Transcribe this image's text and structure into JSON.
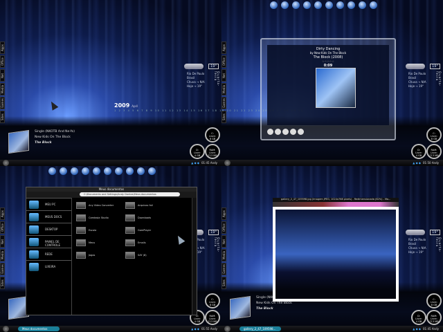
{
  "sidebar_tabs": [
    "Apps",
    "Office",
    "Net",
    "Media",
    "Games",
    "Sites"
  ],
  "weather": {
    "temp": "19°",
    "city": "Rio De Paulo",
    "country": "Brasil",
    "line1": "Chuva → N/A",
    "line2": "Hoje → 19°",
    "label": "Quarta-feira"
  },
  "drives": [
    {
      "name": "C:",
      "label": "Livre:",
      "value": "8 GB"
    },
    {
      "name": "D:",
      "label": "Livre:",
      "value": "4 GB"
    },
    {
      "name": "RAM:",
      "label": "Livre:",
      "value": "713 MB"
    }
  ],
  "now_playing": {
    "line1": "Single (NKOTB And Ne-Yo)",
    "line2": "New Kids On The Block",
    "line3": "The Block"
  },
  "calendar": {
    "year": "2009",
    "month": "April",
    "days": [
      "1",
      "2",
      "3",
      "4",
      "5",
      "6",
      "7",
      "8",
      "9",
      "10",
      "11",
      "12",
      "13",
      "14",
      "15",
      "16",
      "17",
      "18",
      "19",
      "20",
      "21",
      "22",
      "23",
      "24",
      "25",
      "26",
      "27",
      "28",
      "29",
      "30"
    ]
  },
  "clocks": [
    "01:45 Andy",
    "01:50 Andy",
    "01:55 Andy",
    "01:45 Andy"
  ],
  "player": {
    "song": "Dirty Dancing",
    "artist": "by New Kids On The Block",
    "album": "The Block (2008)",
    "time": "0:09",
    "rating": "☆☆☆☆☆"
  },
  "explorer": {
    "title": "Meus documentos",
    "address": "C:\\Documents and Settings\\Andy Dantas\\Meus documentos",
    "places": [
      "MEU PC",
      "MEUS DOCS",
      "DESKTOP",
      "PAINEL DE CONTROLE",
      "REDE",
      "LIXEIRA"
    ],
    "folders": [
      "Any Video Converter",
      "Arquivos fail",
      "Camtasia Studio",
      "Downloads",
      "Escola",
      "GomPlayer",
      "Meus",
      "Emails",
      "Jogos",
      "SAY (8)"
    ]
  },
  "taskbar_buttons": {
    "q2": "Meus documentos",
    "q3": "gallery_2_47_109598..."
  },
  "viewer": {
    "title": "gallery_2_47_109598.jpg (Imagem JPEG, 1024x768 pixels) - Redimensionada (62%) - Mo..."
  },
  "colors": {
    "accent": "#1a7f9a",
    "desktop": "#0d1b4a"
  }
}
